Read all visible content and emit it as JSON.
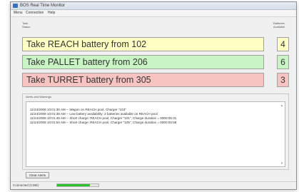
{
  "window": {
    "title": "BOS Real Time Monitor"
  },
  "menu": [
    "Menu",
    "Connection",
    "Help"
  ],
  "headers": {
    "task_status": "Task\nStatus",
    "batteries_available": "Batteries\nAvailable"
  },
  "tasks": [
    {
      "text": "Take REACH battery from 102",
      "count": "4",
      "color": "#ffffc4"
    },
    {
      "text": "Take PALLET battery from 206",
      "count": "6",
      "color": "#c9f5c4"
    },
    {
      "text": "Take TURRET battery from 305",
      "count": "3",
      "color": "#f7c4c2"
    }
  ],
  "alerts": {
    "label": "Alerts and Warnings",
    "lines": [
      "11/24/2008 10:01:30 AM -- Wagon on REACH pool, Charger \"103\"",
      "11/24/2008 10:01:38 AM -- Low battery availability: 2 batteries available on REACH pool",
      "11/24/2008 10:01:48 AM -- Short charge: REACH pool, Charger \"101\", Charge duration = 0000:05:31",
      "11/24/2008 10:01:54 AM -- Short charge: REACH pool, Charger \"105\", Charge duration = 0000:00:58"
    ],
    "clear_button": "Clear Alerts"
  },
  "status": {
    "text": "Connected (CWE)",
    "progress_fraction": 0.8,
    "progress_color": "#2fbf2f"
  }
}
